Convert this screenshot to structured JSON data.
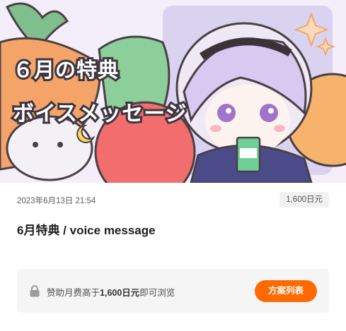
{
  "post": {
    "hero_text_line1": "６月の特典",
    "hero_text_line2": "ボイスメッセージ",
    "date": "2023年6月13日 21:54",
    "price_badge": "1,600日元",
    "title": "6月特典 / voice message"
  },
  "locked": {
    "text_prefix": "赞助月费高于",
    "amount": "1,600日元",
    "text_suffix": "即可浏览",
    "plan_button_label": "方案列表"
  },
  "colors": {
    "accent": "#ff6a00",
    "badge_bg": "#f1f1f1",
    "locked_bg": "#f5f5f5"
  },
  "icons": [
    "lock-icon"
  ]
}
